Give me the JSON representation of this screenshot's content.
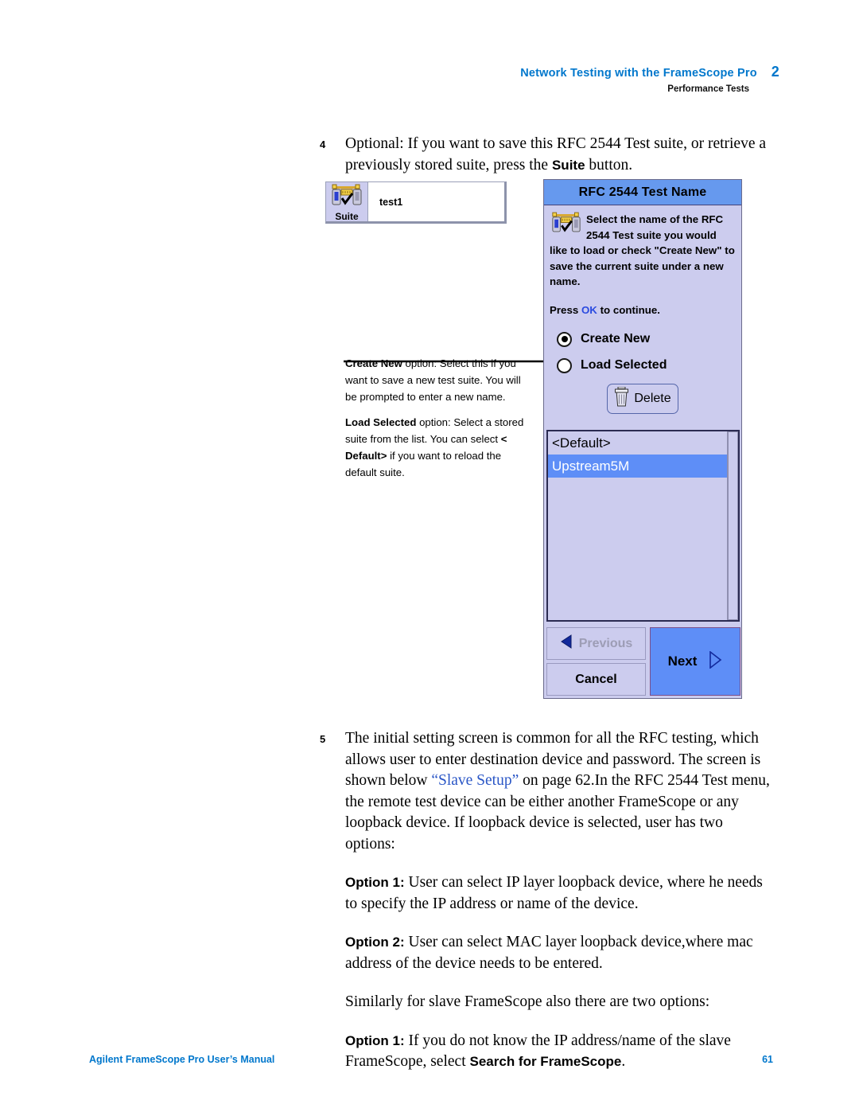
{
  "header": {
    "chapter_title": "Network Testing with the FrameScope Pro",
    "chapter_number": "2",
    "section": "Performance Tests"
  },
  "steps": [
    {
      "number": "4",
      "text_before": "Optional: If you want to save this RFC 2544 Test suite, or retrieve a previously stored suite, press the ",
      "bold": "Suite",
      "text_after": " button."
    },
    {
      "number": "5",
      "text_a": "The initial setting screen is common for all the RFC testing, which allows user to enter destination device and password. The screen is shown below ",
      "link": "“Slave Setup”",
      "text_b": " on page 62.In the RFC 2544 Test menu, the remote test device can be either another FrameScope or any loopback device. If loopback device is selected, user has two options:"
    }
  ],
  "paragraphs": [
    {
      "label": "Option 1:",
      "text": " User can select IP layer loopback device, where he needs to specify the IP address or name of the device."
    },
    {
      "label": "Option 2:",
      "text": " User can select MAC layer loopback device,where mac address of the device needs to be entered."
    },
    {
      "label": "",
      "text": "Similarly for slave FrameScope also there are two options:"
    },
    {
      "label": "Option 1:",
      "text": " If you do not know the IP address/name of the slave FrameScope, select ",
      "bold_tail": "Search for FrameScope",
      "tail": "."
    }
  ],
  "suite_screenshot": {
    "button_label": "Suite",
    "field_value": "test1",
    "icon": "suite-test-icon"
  },
  "device_dialog": {
    "title": "RFC 2544 Test Name",
    "instruction": "Select the name of the RFC 2544 Test suite you would like to load or check \"Create New\" to save the current suite under a new name.",
    "press_prefix": "Press ",
    "press_key": "OK",
    "press_suffix": " to continue.",
    "radios": [
      {
        "label": "Create New",
        "selected": true
      },
      {
        "label": "Load Selected",
        "selected": false
      }
    ],
    "delete_button": "Delete",
    "list": {
      "items": [
        {
          "label": "<Default>",
          "selected": false
        },
        {
          "label": "Upstream5M",
          "selected": true
        }
      ]
    },
    "buttons": {
      "previous": "Previous",
      "cancel": "Cancel",
      "next": "Next"
    },
    "colors": {
      "title_bar": "#6699ee",
      "body": "#ccccee",
      "selection": "#5e8ef7"
    }
  },
  "callouts": [
    {
      "bold": "Create New",
      "text": " option: Select this if you want to save a new test suite. You will be prompted to enter a new name."
    },
    {
      "bold": "Load Selected",
      "text_a": " option: Select a stored suite from the list. You can select ",
      "bold_b": "< Default>",
      "text_b": " if you want to reload the default suite."
    }
  ],
  "footer": {
    "manual_title": "Agilent FrameScope Pro User’s Manual",
    "page_number": "61"
  }
}
